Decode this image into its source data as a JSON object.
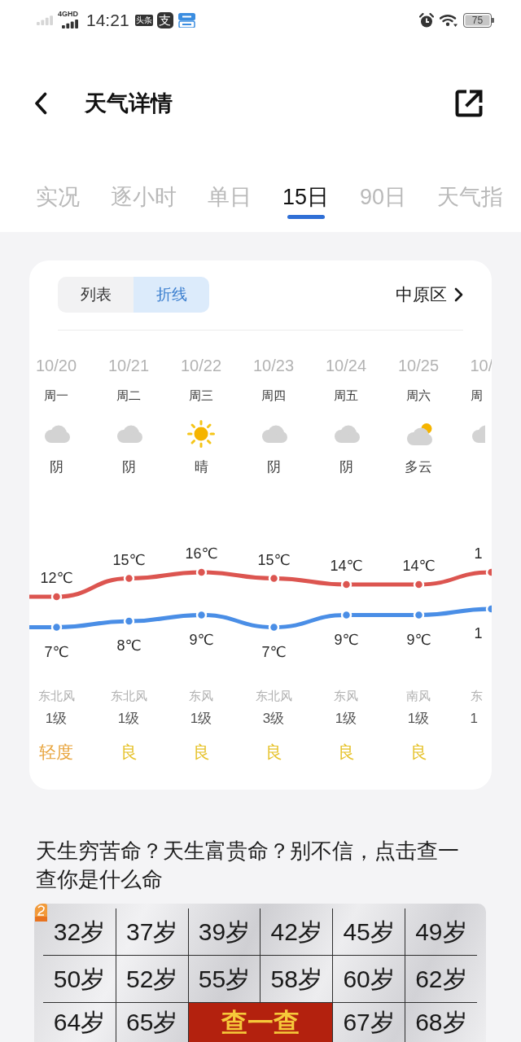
{
  "status_bar": {
    "network": "4GHD",
    "time": "14:21",
    "app_icons": [
      {
        "kind": "badge",
        "text": "头条"
      },
      {
        "kind": "tile",
        "text": "支"
      }
    ],
    "battery": "75"
  },
  "header": {
    "title": "天气详情"
  },
  "tabs": [
    {
      "label": "实况",
      "selected": false
    },
    {
      "label": "逐小时",
      "selected": false
    },
    {
      "label": "单日",
      "selected": false
    },
    {
      "label": "15日",
      "selected": true
    },
    {
      "label": "90日",
      "selected": false
    },
    {
      "label": "天气指",
      "selected": false
    }
  ],
  "forecast": {
    "view_toggle": [
      {
        "label": "列表",
        "selected": false
      },
      {
        "label": "折线",
        "selected": true
      }
    ],
    "location": "中原区",
    "days": [
      {
        "date": "10/20",
        "weekday": "周一",
        "kind": "overcast",
        "condition": "阴",
        "wind": "东北风",
        "wind_level": "1级",
        "air_quality": {
          "label": "轻度",
          "color": "#e8a43c"
        }
      },
      {
        "date": "10/21",
        "weekday": "周二",
        "kind": "overcast",
        "condition": "阴",
        "wind": "东北风",
        "wind_level": "1级",
        "air_quality": {
          "label": "良",
          "color": "#e6c22a"
        }
      },
      {
        "date": "10/22",
        "weekday": "周三",
        "kind": "sunny",
        "condition": "晴",
        "wind": "东风",
        "wind_level": "1级",
        "air_quality": {
          "label": "良",
          "color": "#e6c22a"
        }
      },
      {
        "date": "10/23",
        "weekday": "周四",
        "kind": "overcast",
        "condition": "阴",
        "wind": "东北风",
        "wind_level": "3级",
        "air_quality": {
          "label": "良",
          "color": "#e6c22a"
        }
      },
      {
        "date": "10/24",
        "weekday": "周五",
        "kind": "overcast",
        "condition": "阴",
        "wind": "东风",
        "wind_level": "1级",
        "air_quality": {
          "label": "良",
          "color": "#e6c22a"
        }
      },
      {
        "date": "10/25",
        "weekday": "周六",
        "kind": "partlycloudy",
        "condition": "多云",
        "wind": "南风",
        "wind_level": "1级",
        "air_quality": {
          "label": "良",
          "color": "#e6c22a"
        }
      },
      {
        "date": "10/",
        "weekday": "周",
        "kind": "overcast",
        "wind": "东",
        "wind_level": "1"
      }
    ],
    "chart_data": {
      "type": "line",
      "series": [
        {
          "color": "#dc5550",
          "marker": "circle",
          "values": [
            12,
            15,
            16,
            15,
            14,
            14,
            16
          ],
          "value_labels": [
            "12℃",
            "15℃",
            "16℃",
            "15℃",
            "14℃",
            "14℃",
            null
          ]
        },
        {
          "color": "#4a8ee6",
          "marker": "circle",
          "values": [
            7,
            8,
            9,
            7,
            9,
            9,
            10
          ],
          "value_labels": [
            "7℃",
            "8℃",
            "9℃",
            "7℃",
            "9℃",
            "9℃",
            null
          ]
        }
      ],
      "annotations": [
        {
          "y": 16,
          "text": "1"
        },
        {
          "y": 10,
          "text": "1"
        }
      ]
    }
  },
  "ad": {
    "headline": "天生穷苦命？天生富贵命？别不信，点击查一查你是什么命",
    "rows": [
      [
        {
          "kind": "age",
          "text": "32岁"
        },
        {
          "kind": "age",
          "text": "37岁"
        },
        {
          "kind": "age",
          "text": "39岁"
        },
        {
          "kind": "age",
          "text": "42岁"
        },
        {
          "kind": "age",
          "text": "45岁"
        },
        {
          "kind": "age",
          "text": "49岁"
        }
      ],
      [
        {
          "kind": "age",
          "text": "50岁"
        },
        {
          "kind": "age",
          "text": "52岁"
        },
        {
          "kind": "age",
          "text": "55岁"
        },
        {
          "kind": "age",
          "text": "58岁"
        },
        {
          "kind": "age",
          "text": "60岁"
        },
        {
          "kind": "age",
          "text": "62岁"
        }
      ],
      [
        {
          "kind": "age",
          "text": "64岁"
        },
        {
          "kind": "age",
          "text": "65岁"
        },
        {
          "kind": "action",
          "text": "查一查"
        },
        {
          "kind": "merged"
        },
        {
          "kind": "age",
          "text": "67岁"
        },
        {
          "kind": "age",
          "text": "68岁"
        }
      ]
    ]
  }
}
